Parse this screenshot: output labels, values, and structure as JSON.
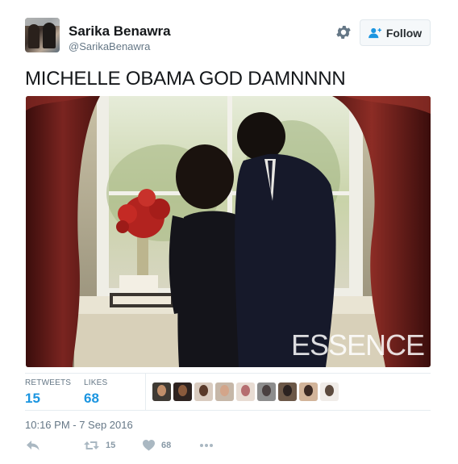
{
  "user": {
    "display_name": "Sarika Benawra",
    "handle": "@SarikaBenawra"
  },
  "follow_button": {
    "label": "Follow"
  },
  "tweet": {
    "text": "MICHELLE OBAMA GOD DAMNNNN",
    "photo_watermark": "ESSENCE"
  },
  "stats": {
    "retweets_label": "RETWEETS",
    "retweets_value": "15",
    "likes_label": "LIKES",
    "likes_value": "68"
  },
  "likers": [
    {
      "name": "liker-1",
      "bg": "#3f3a34",
      "face": "#c08e6a"
    },
    {
      "name": "liker-2",
      "bg": "#2e2320",
      "face": "#8a5a3c"
    },
    {
      "name": "liker-3",
      "bg": "#d9cbbf",
      "face": "#5a3a2a"
    },
    {
      "name": "liker-4",
      "bg": "#c6b7a8",
      "face": "#d3a58a"
    },
    {
      "name": "liker-5",
      "bg": "#e8dcd3",
      "face": "#b56e70"
    },
    {
      "name": "liker-6",
      "bg": "#8d8d8d",
      "face": "#4a4040"
    },
    {
      "name": "liker-7",
      "bg": "#6c5848",
      "face": "#2b2220"
    },
    {
      "name": "liker-8",
      "bg": "#d2b49a",
      "face": "#3c2a24"
    },
    {
      "name": "liker-9",
      "bg": "#f0ece8",
      "face": "#5c4a3e"
    }
  ],
  "timestamp": "10:16 PM - 7 Sep 2016",
  "actions": {
    "reply_icon": "reply-icon",
    "retweet_icon": "retweet-icon",
    "retweet_count": "15",
    "like_icon": "heart-icon",
    "like_count": "68",
    "more_icon": "more-dots-icon"
  },
  "colors": {
    "link_blue": "#1b95e0",
    "muted": "#657786",
    "text": "#14171a"
  }
}
